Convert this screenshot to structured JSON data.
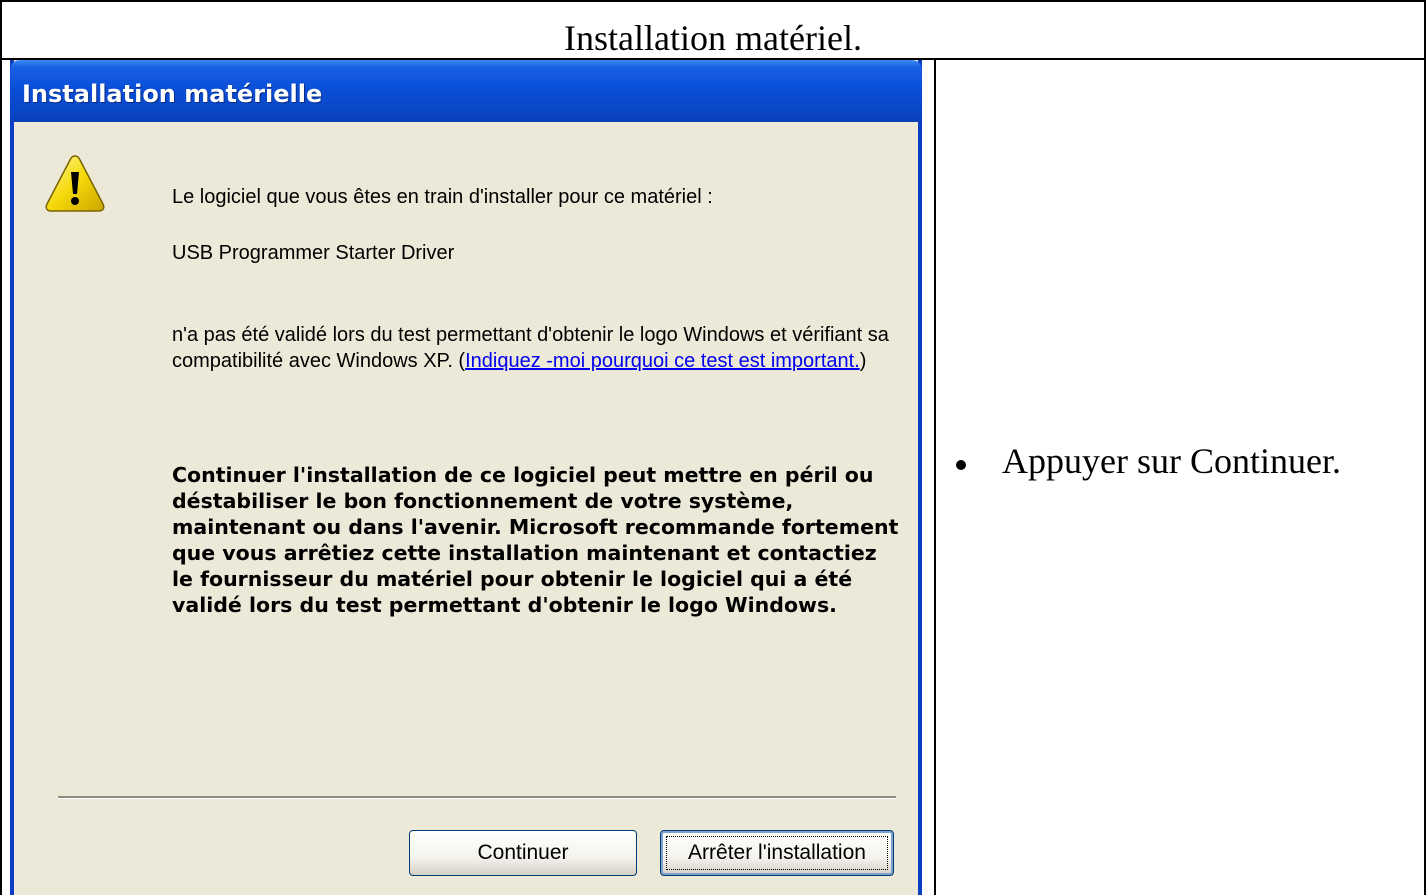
{
  "header": {
    "title": "Installation matériel."
  },
  "dialog": {
    "title": "Installation matérielle",
    "intro_line": "Le logiciel que vous êtes en train d'installer pour ce matériel :",
    "driver_name": "USB Programmer Starter Driver",
    "validation_text": "n'a pas été validé lors du test permettant d'obtenir le logo Windows et vérifiant sa compatibilité avec Windows XP. (",
    "validation_link": "Indiquez -moi pourquoi ce test est important.",
    "validation_close": ")",
    "warning_text": "Continuer l'installation de ce logiciel peut mettre en péril ou déstabiliser le bon fonctionnement de votre système, maintenant ou dans l'avenir. Microsoft recommande fortement que vous arrêtiez cette installation maintenant et contactiez le fournisseur du matériel pour obtenir le logiciel qui a été validé lors du test permettant d'obtenir le logo Windows.",
    "buttons": {
      "continue_label": "Continuer",
      "stop_label": "Arrêter l'installation"
    },
    "icon": "warning-icon"
  },
  "instructions": {
    "step": "Appuyer sur Continuer."
  },
  "colors": {
    "titlebar_blue": "#0a4fd8",
    "dialog_background": "#ece9d8",
    "warning_yellow": "#f5d90a",
    "link_blue": "#0000ee"
  }
}
